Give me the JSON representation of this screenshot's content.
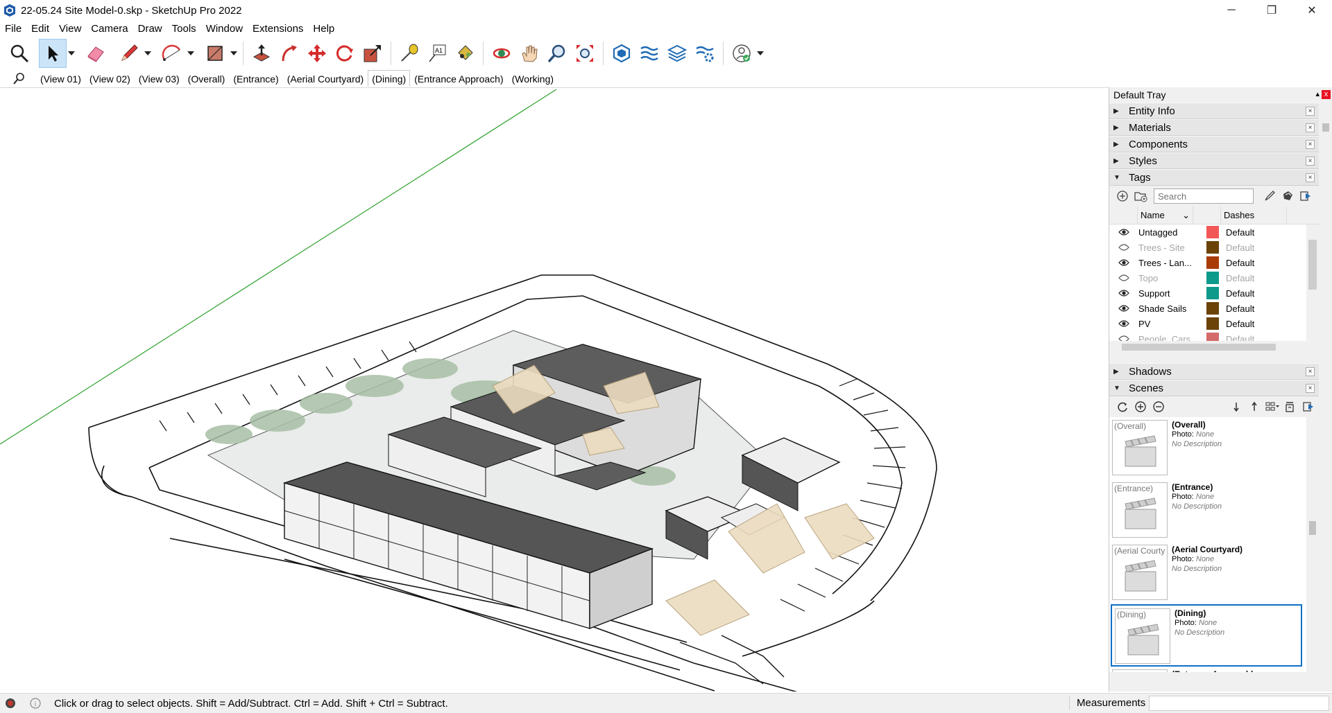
{
  "window": {
    "title": "22-05.24 Site Model-0.skp - SketchUp Pro 2022",
    "minimize": "─",
    "restore": "❐",
    "close": "✕"
  },
  "menu": [
    "File",
    "Edit",
    "View",
    "Camera",
    "Draw",
    "Tools",
    "Window",
    "Extensions",
    "Help"
  ],
  "toolbar": {
    "tools": [
      "search-tool",
      "select-tool",
      "eraser-tool",
      "pencil-tool",
      "arc-tool",
      "rectangle-tool",
      "push-pull-tool",
      "follow-me-tool",
      "move-tool",
      "rotate-tool",
      "scale-tool",
      "tape-measure-tool",
      "text-tool",
      "paint-bucket-tool",
      "orbit-tool",
      "pan-tool",
      "zoom-tool",
      "zoom-extents-tool",
      "sandbox-tool",
      "section-tool",
      "layers-tool",
      "extension-tool",
      "account-tool"
    ]
  },
  "scenes_bar": {
    "tabs": [
      "(View 01)",
      "(View 02)",
      "(View 03)",
      "(Overall)",
      "(Entrance)",
      "(Aerial Courtyard)",
      "(Dining)",
      "(Entrance Approach)",
      "(Working)"
    ],
    "active_index": 6
  },
  "tray": {
    "title": "Default Tray",
    "pin": "▴",
    "close": "x",
    "panels": {
      "entity_info": "Entity Info",
      "materials": "Materials",
      "components": "Components",
      "styles": "Styles",
      "tags": "Tags",
      "shadows": "Shadows",
      "scenes": "Scenes"
    },
    "tags": {
      "search_placeholder": "Search",
      "col_name": "Name",
      "col_dashes": "Dashes",
      "rows": [
        {
          "name": "Untagged",
          "visible": true,
          "color": "#f25757",
          "dash": "Default"
        },
        {
          "name": "Trees - Site",
          "visible": false,
          "color": "#6b4307",
          "dash": "Default"
        },
        {
          "name": "Trees - Lan...",
          "visible": true,
          "color": "#a83b06",
          "dash": "Default"
        },
        {
          "name": "Topo",
          "visible": false,
          "color": "#0d9a8b",
          "dash": "Default"
        },
        {
          "name": "Support",
          "visible": true,
          "color": "#0d9a8b",
          "dash": "Default"
        },
        {
          "name": "Shade Sails",
          "visible": true,
          "color": "#6b4307",
          "dash": "Default"
        },
        {
          "name": "PV",
          "visible": true,
          "color": "#6b4307",
          "dash": "Default"
        },
        {
          "name": "People, Cars",
          "visible": false,
          "color": "#d46a6a",
          "dash": "Default"
        }
      ]
    },
    "scenes": {
      "photo_label": "Photo:",
      "photo_value": "None",
      "desc_value": "No Description",
      "items": [
        {
          "thumb": "(Overall)",
          "name": "(Overall)"
        },
        {
          "thumb": "(Entrance)",
          "name": "(Entrance)"
        },
        {
          "thumb": "(Aerial Courty",
          "name": "(Aerial Courtyard)"
        },
        {
          "thumb": "(Dining)",
          "name": "(Dining)"
        },
        {
          "thumb": "(Entrance App",
          "name": "(Entrance Approach)"
        }
      ],
      "selected_index": 3
    }
  },
  "status": {
    "message": "Click or drag to select objects. Shift = Add/Subtract. Ctrl = Add. Shift + Ctrl = Subtract.",
    "measurements_label": "Measurements",
    "measurements_value": ""
  }
}
